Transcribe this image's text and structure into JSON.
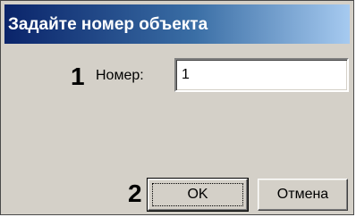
{
  "window": {
    "title": "Задайте номер объекта"
  },
  "callouts": {
    "first": "1",
    "second": "2"
  },
  "form": {
    "number_label": "Номер:",
    "number_value": "1"
  },
  "buttons": {
    "ok_label": "OK",
    "cancel_label": "Отмена"
  }
}
